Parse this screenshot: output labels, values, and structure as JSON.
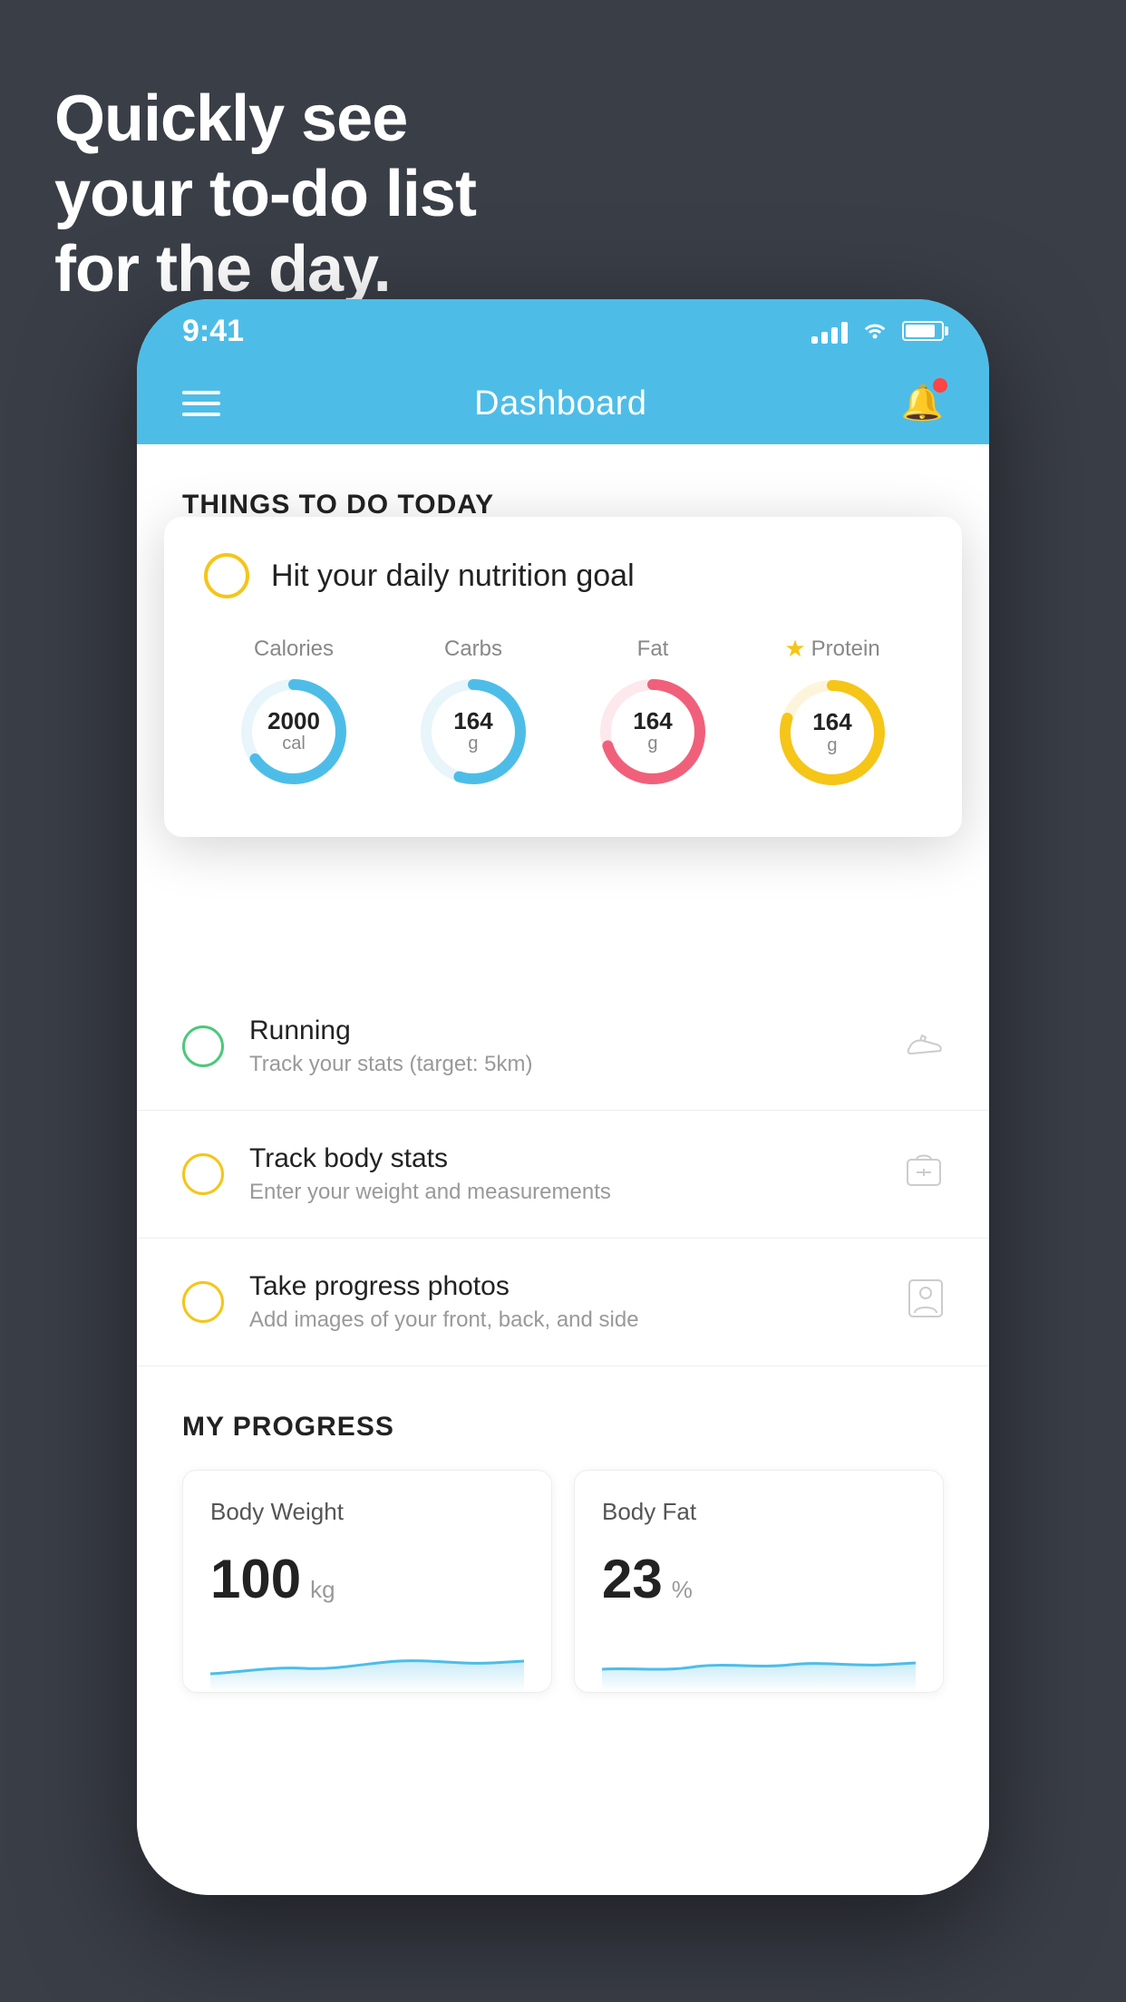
{
  "background": {
    "color": "#3a3e47"
  },
  "headline": {
    "line1": "Quickly see",
    "line2": "your to-do list",
    "line3": "for the day."
  },
  "phone": {
    "status_bar": {
      "time": "9:41",
      "signal": "signal",
      "wifi": "wifi",
      "battery": "battery"
    },
    "nav_bar": {
      "menu_icon": "hamburger",
      "title": "Dashboard",
      "bell_icon": "bell"
    },
    "section_header": "THINGS TO DO TODAY",
    "floating_card": {
      "checkbox_color": "#f5c518",
      "title": "Hit your daily nutrition goal",
      "macros": [
        {
          "label": "Calories",
          "value": "2000",
          "unit": "cal",
          "color": "#4dbde8",
          "percent": 65
        },
        {
          "label": "Carbs",
          "value": "164",
          "unit": "g",
          "color": "#4dbde8",
          "percent": 55
        },
        {
          "label": "Fat",
          "value": "164",
          "unit": "g",
          "color": "#f0607a",
          "percent": 70
        },
        {
          "label": "Protein",
          "value": "164",
          "unit": "g",
          "color": "#f5c518",
          "percent": 80,
          "starred": true
        }
      ]
    },
    "todo_items": [
      {
        "id": "running",
        "circle_color": "green",
        "title": "Running",
        "subtitle": "Track your stats (target: 5km)",
        "icon": "shoe"
      },
      {
        "id": "body-stats",
        "circle_color": "yellow",
        "title": "Track body stats",
        "subtitle": "Enter your weight and measurements",
        "icon": "scale"
      },
      {
        "id": "photos",
        "circle_color": "yellow",
        "title": "Take progress photos",
        "subtitle": "Add images of your front, back, and side",
        "icon": "person"
      }
    ],
    "my_progress": {
      "title": "MY PROGRESS",
      "cards": [
        {
          "id": "body-weight",
          "title": "Body Weight",
          "value": "100",
          "unit": "kg"
        },
        {
          "id": "body-fat",
          "title": "Body Fat",
          "value": "23",
          "unit": "%"
        }
      ]
    }
  }
}
